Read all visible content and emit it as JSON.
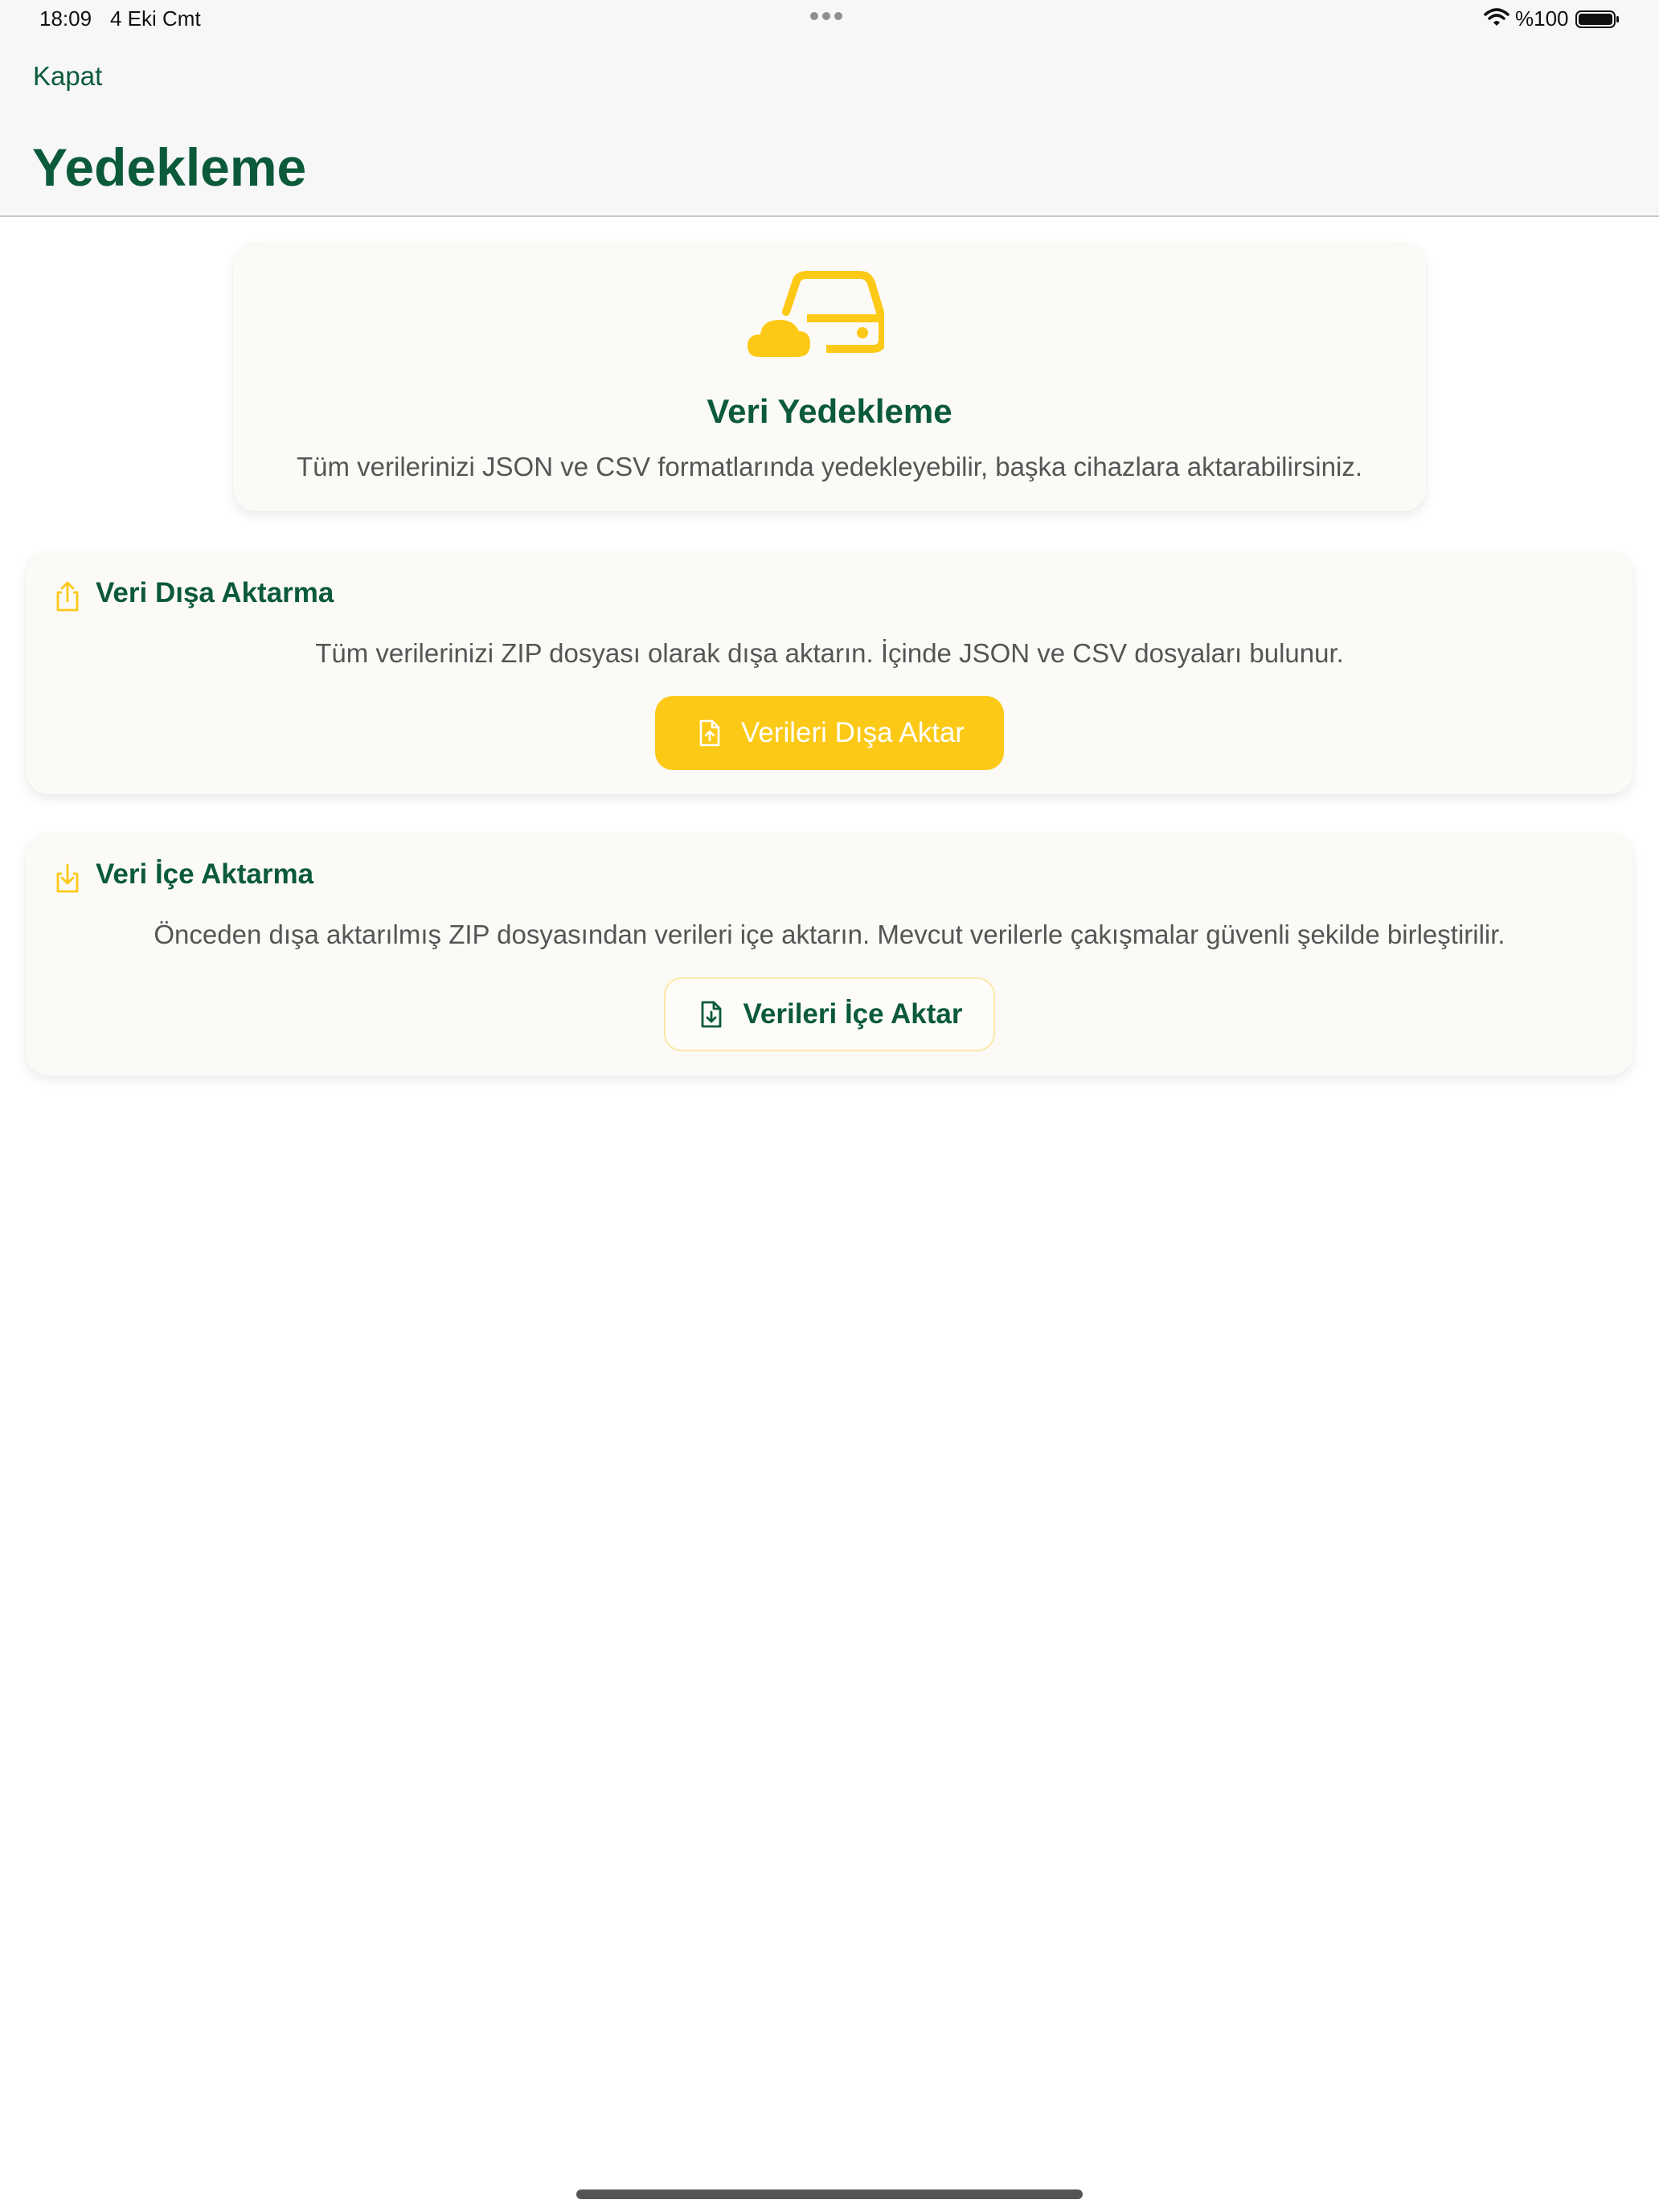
{
  "status_bar": {
    "time": "18:09",
    "date": "4 Eki Cmt",
    "battery": "%100"
  },
  "header": {
    "close_label": "Kapat",
    "title": "Yedekleme"
  },
  "hero": {
    "icon": "cloud-drive-icon",
    "title": "Veri Yedekleme",
    "description": "Tüm verilerinizi JSON ve CSV formatlarında yedekleyebilir, başka cihazlara aktarabilirsiniz."
  },
  "export": {
    "icon": "share-upload-icon",
    "title": "Veri Dışa Aktarma",
    "description": "Tüm verilerinizi ZIP dosyası olarak dışa aktarın. İçinde JSON ve CSV dosyaları bulunur.",
    "button_label": "Verileri Dışa Aktar",
    "button_icon": "document-upload-icon"
  },
  "import": {
    "icon": "tray-download-icon",
    "title": "Veri İçe Aktarma",
    "description": "Önceden dışa aktarılmış ZIP dosyasından verileri içe aktarın. Mevcut verilerle çakışmalar güvenli şekilde birleştirilir.",
    "button_label": "Verileri İçe Aktar",
    "button_icon": "document-download-icon"
  },
  "colors": {
    "brand_green": "#0b5a3a",
    "accent_yellow": "#fcc917",
    "card_background": "#fbfaf7"
  }
}
